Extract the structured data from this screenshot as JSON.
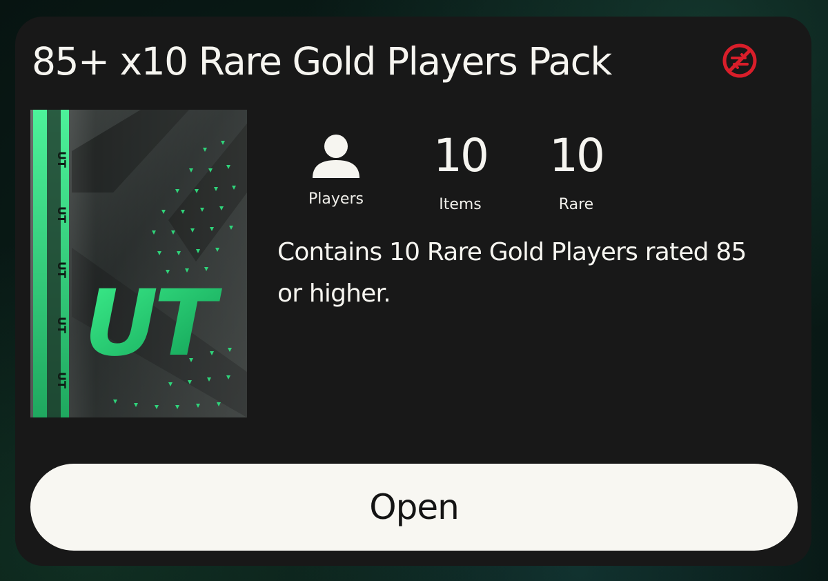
{
  "pack": {
    "title": "85+ x10 Rare Gold Players Pack",
    "untradeable_icon": "untradeable-icon",
    "description": "Contains 10 Rare Gold Players rated 85 or higher.",
    "art_text": "UT",
    "art_strip_text": "UT"
  },
  "stats": {
    "players": {
      "icon": "player-silhouette-icon",
      "label": "Players"
    },
    "items": {
      "value": "10",
      "label": "Items"
    },
    "rare": {
      "value": "10",
      "label": "Rare"
    }
  },
  "actions": {
    "open_label": "Open"
  },
  "colors": {
    "card_bg": "#181818",
    "text": "#f6f5f0",
    "button_bg": "#f8f7f2",
    "button_text": "#141414",
    "accent_green": "#2fd47a",
    "untradeable_red": "#d91e2a"
  }
}
